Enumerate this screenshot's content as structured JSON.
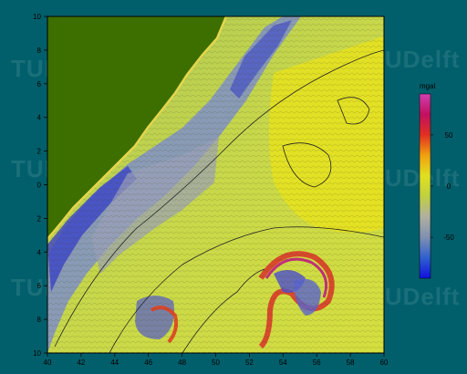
{
  "chart_data": {
    "type": "heatmap",
    "title": "",
    "xlabel": "",
    "ylabel": "",
    "xlim": [
      40,
      60
    ],
    "ylim": [
      -10,
      10
    ],
    "x_ticks": [
      "40",
      "42",
      "44",
      "46",
      "48",
      "50",
      "52",
      "54",
      "56",
      "58",
      "60"
    ],
    "y_ticks": [
      "10",
      "8",
      "6",
      "4",
      "2",
      "0",
      "2",
      "4",
      "6",
      "8",
      "10"
    ],
    "colorbar": {
      "unit": "mgal",
      "range": [
        -90,
        90
      ],
      "ticks": [
        {
          "label": "50",
          "value": 50
        },
        {
          "label": "0",
          "value": 0
        },
        {
          "label": "-50",
          "value": -50
        }
      ],
      "stops": [
        "#1010e0",
        "#3060d0",
        "#8090b0",
        "#b0b0a0",
        "#c0d040",
        "#e0e020",
        "#f0a010",
        "#e03020",
        "#c01060",
        "#d040b0"
      ]
    },
    "land_mask_color": "#3d6e00"
  },
  "watermark": {
    "text": "TUDelft"
  }
}
